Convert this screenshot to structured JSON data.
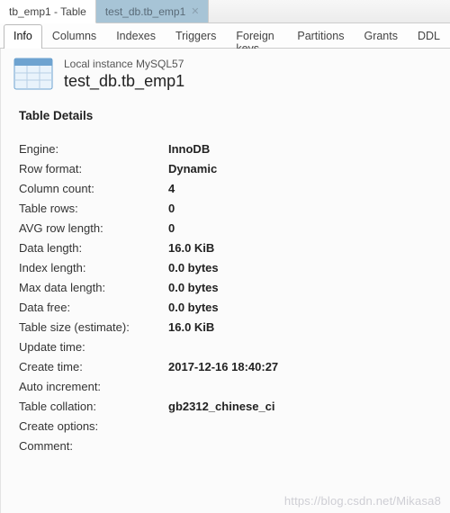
{
  "windowTabs": [
    {
      "label": "tb_emp1 - Table",
      "active": true
    },
    {
      "label": "test_db.tb_emp1",
      "active": false,
      "closable": true
    }
  ],
  "subTabs": [
    "Info",
    "Columns",
    "Indexes",
    "Triggers",
    "Foreign keys",
    "Partitions",
    "Grants",
    "DDL"
  ],
  "activeSubTab": "Info",
  "connection": "Local instance MySQL57",
  "objectName": "test_db.tb_emp1",
  "sectionTitle": "Table Details",
  "details": [
    {
      "label": "Engine:",
      "value": "InnoDB"
    },
    {
      "label": "Row format:",
      "value": "Dynamic"
    },
    {
      "label": "Column count:",
      "value": "4"
    },
    {
      "label": "Table rows:",
      "value": "0"
    },
    {
      "label": "AVG row length:",
      "value": "0"
    },
    {
      "label": "Data length:",
      "value": "16.0 KiB"
    },
    {
      "label": "Index length:",
      "value": "0.0 bytes"
    },
    {
      "label": "Max data length:",
      "value": "0.0 bytes"
    },
    {
      "label": "Data free:",
      "value": "0.0 bytes"
    },
    {
      "label": "Table size (estimate):",
      "value": "16.0 KiB"
    },
    {
      "label": "Update time:",
      "value": ""
    },
    {
      "label": "Create time:",
      "value": "2017-12-16 18:40:27"
    },
    {
      "label": "Auto increment:",
      "value": ""
    },
    {
      "label": "Table collation:",
      "value": "gb2312_chinese_ci"
    },
    {
      "label": "Create options:",
      "value": ""
    },
    {
      "label": "Comment:",
      "value": ""
    }
  ],
  "watermark": "https://blog.csdn.net/Mikasa8"
}
